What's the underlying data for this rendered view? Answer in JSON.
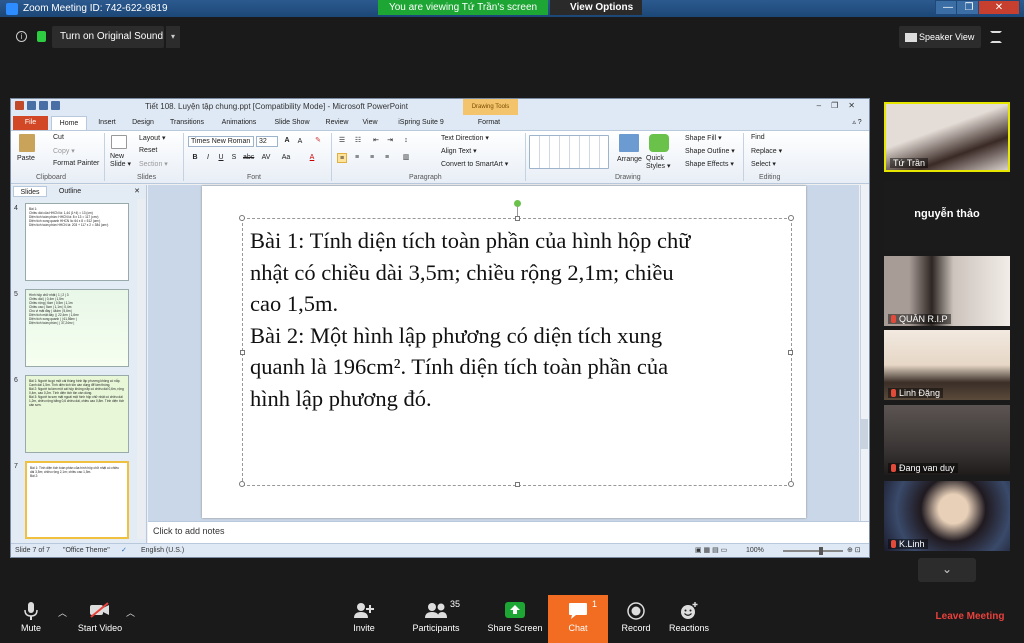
{
  "window": {
    "title": "Zoom Meeting ID: 742-622-9819",
    "viewing_banner": "You are viewing Tứ Trần's screen",
    "view_options": "View Options ⌄",
    "min": "—",
    "max": "❐",
    "close": "✕"
  },
  "top_bar": {
    "original_sound": "Turn on Original Sound",
    "speaker_view": "Speaker View"
  },
  "ppt": {
    "title": "Tiết 108. Luyện tập chung.ppt [Compatibility Mode]  -  Microsoft PowerPoint",
    "drawing_tools": "Drawing Tools",
    "tabs": [
      "File",
      "Home",
      "Insert",
      "Design",
      "Transitions",
      "Animations",
      "Slide Show",
      "Review",
      "View",
      "iSpring Suite 9",
      "Format"
    ],
    "ribbon": {
      "cut": "Cut",
      "copy": "Copy ▾",
      "format_painter": "Format Painter",
      "paste": "Paste",
      "new_slide": "New Slide ▾",
      "layout": "Layout ▾",
      "reset": "Reset",
      "section": "Section ▾",
      "font_name": "Times New Roman",
      "font_size": "32",
      "text_direction": "Text Direction ▾",
      "align_text": "Align Text ▾",
      "convert_smartart": "Convert to SmartArt ▾",
      "arrange": "Arrange",
      "quick_styles": "Quick Styles ▾",
      "shape_fill": "Shape Fill ▾",
      "shape_outline": "Shape Outline ▾",
      "shape_effects": "Shape Effects ▾",
      "find": "Find",
      "replace": "Replace ▾",
      "select": "Select ▾",
      "groups": {
        "clipboard": "Clipboard",
        "slides": "Slides",
        "font": "Font",
        "paragraph": "Paragraph",
        "drawing": "Drawing",
        "editing": "Editing"
      }
    },
    "panel_tabs": {
      "slides": "Slides",
      "outline": "Outline"
    },
    "thumbnails": [
      {
        "num": "4",
        "text": "Bài 1:\nChiều dài của HHCN là: 1,44 (1+4) = 13 (cm)\nDiện tích toàn phần: HHCN là: 8 x 13 = 117 (cm²)\nDiện tích xung quanh HHCN là: 64 x 8 = 512 (cm²)\nDiện tích toàn phần HHCN là: 203 + 117 x 2 = 384 (cm²)"
      },
      {
        "num": "5",
        "text": "Hình hộp chữ nhật | 1 | 2 | 3\nChiều dài | | 0,4m | 1,5m\nChiều rộng | 6cm | 0,5m | 1,1m\nChiều cao | 5cm | 1,1m | 0,4m\nChu vi mặt đáy | 44dm | 5,6m |\nDiện tích mặt đáy | | 22,4m² | 1,6m²\nDiện tích xung quanh | | 61,56m² |\nDiện tích toàn phần | | 37,24m² |"
      },
      {
        "num": "6",
        "text": "Bài 1: Người ta gò một cái thùng hình lập phương không có nắp. Cạnh dài 1,5m. Tính diện tích tôn cần dùng để làm thùng.\nBài 2: Người ta làm một cái hộp không nắp có chiều dài 0,6m, rộng 0,4m, cao 0,2m. Tính diện tích tôn cần dùng.\nBài 3: Người ta sơn mặt ngoài một hình hộp chữ nhật có chiều dài 1,2m, chiều rộng bằng 0,6 chiều dài, chiều cao 0,8m. Tính diện tích cần sơn."
      },
      {
        "num": "7",
        "text": "Bài 1: Tính diện tích toàn phần của hình hộp chữ nhật có chiều dài 3,5m; chiều rộng 2,1m; chiều cao 1,5m.\nBài 2:"
      }
    ],
    "slide_text": "Bài 1: Tính diện tích toàn phần của hình hộp chữ\nnhật có chiều dài 3,5m; chiều rộng 2,1m; chiều\ncao 1,5m.\nBài 2: Một hình lập phương có diện tích xung\nquanh là 196cm². Tính diện tích toàn phần của\nhình lập phương đó.",
    "notes_placeholder": "Click to add notes",
    "status": {
      "slide": "Slide 7 of 7",
      "theme": "\"Office Theme\"",
      "language": "English (U.S.)",
      "zoom": "100%"
    }
  },
  "participants_tiles": [
    {
      "name": "Tứ Trần",
      "muted": false
    },
    {
      "name": "nguyễn thảo",
      "muted": false
    },
    {
      "name": "QUÂN R.I.P",
      "muted": true
    },
    {
      "name": "Linh Đặng",
      "muted": true
    },
    {
      "name": "Đang van duy",
      "muted": true
    },
    {
      "name": "K.Linh",
      "muted": true
    }
  ],
  "toolbar": {
    "mute": "Mute",
    "start_video": "Start Video",
    "invite": "Invite",
    "participants": "Participants",
    "participants_count": "35",
    "share_screen": "Share Screen",
    "chat": "Chat",
    "chat_count": "1",
    "record": "Record",
    "reactions": "Reactions",
    "leave": "Leave Meeting"
  },
  "colors": {
    "zoom_green": "#1ea634",
    "chat_orange": "#f26d21",
    "leave_red": "#e8413c",
    "active_speaker": "#e6e600"
  }
}
